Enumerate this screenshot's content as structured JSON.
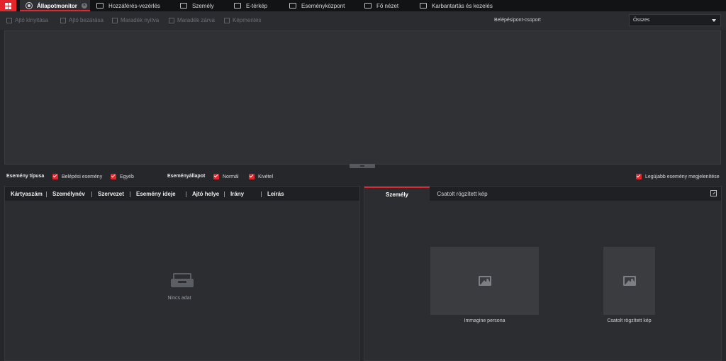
{
  "topbar": {
    "tabs": [
      {
        "label": "Állapotmonitor",
        "icon": "monitor-icon",
        "active": true
      },
      {
        "label": "Hozzáférés-vezérlés",
        "icon": "door-icon"
      },
      {
        "label": "Személy",
        "icon": "person-card-icon"
      },
      {
        "label": "E-térkép",
        "icon": "map-icon"
      },
      {
        "label": "Eseményközpont",
        "icon": "event-center-icon"
      },
      {
        "label": "Fő nézet",
        "icon": "main-view-icon"
      },
      {
        "label": "Karbantartás és kezelés",
        "icon": "maintenance-icon"
      }
    ]
  },
  "toolbar": {
    "buttons": [
      "Ajtó kinyitása",
      "Ajtó bezárása",
      "Maradék nyitva",
      "Maradék zárva",
      "Képmentés"
    ],
    "group_label": "Belépésipont-csoport",
    "group_value": "Összes"
  },
  "filters": {
    "event_type_label": "Esemény típusa",
    "event_type_options": [
      "Belépési esemény",
      "Egyéb"
    ],
    "event_state_label": "Eseményállapot",
    "event_state_options": [
      "Normál",
      "Kivétel"
    ],
    "latest_label": "Legújabb esemény megjelenítése"
  },
  "event_table": {
    "columns": [
      "Kártyaszám",
      "Személynév",
      "Szervezet",
      "Esemény ideje",
      "Ajtó helye",
      "Irány",
      "Leírás"
    ],
    "empty_text": "Nincs adat"
  },
  "detail": {
    "tabs": [
      "Személy",
      "Csatolt rögzített kép"
    ],
    "person_caption": "Immagine persona",
    "captured_caption": "Csatolt rögzített kép"
  },
  "colors": {
    "accent": "#e3262b",
    "background": "#25272b",
    "topbar": "#121315"
  }
}
